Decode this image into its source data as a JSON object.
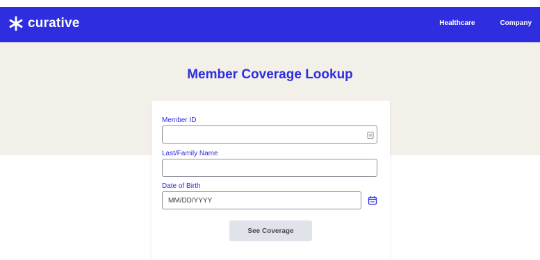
{
  "header": {
    "brand_name": "curative",
    "nav_items": [
      "Healthcare",
      "Company"
    ],
    "colors": {
      "background": "#2e2ee0",
      "text": "#ffffff"
    }
  },
  "hero": {
    "title": "Member Coverage Lookup",
    "background": "#f3f0ea"
  },
  "form": {
    "member_id": {
      "label": "Member ID",
      "value": "",
      "placeholder": "",
      "icon": "id-card-icon"
    },
    "last_name": {
      "label": "Last/Family Name",
      "value": "",
      "placeholder": ""
    },
    "dob": {
      "label": "Date of Birth",
      "value": "",
      "placeholder": "MM/DD/YYYY",
      "icon": "calendar-icon"
    },
    "submit_label": "See Coverage"
  }
}
